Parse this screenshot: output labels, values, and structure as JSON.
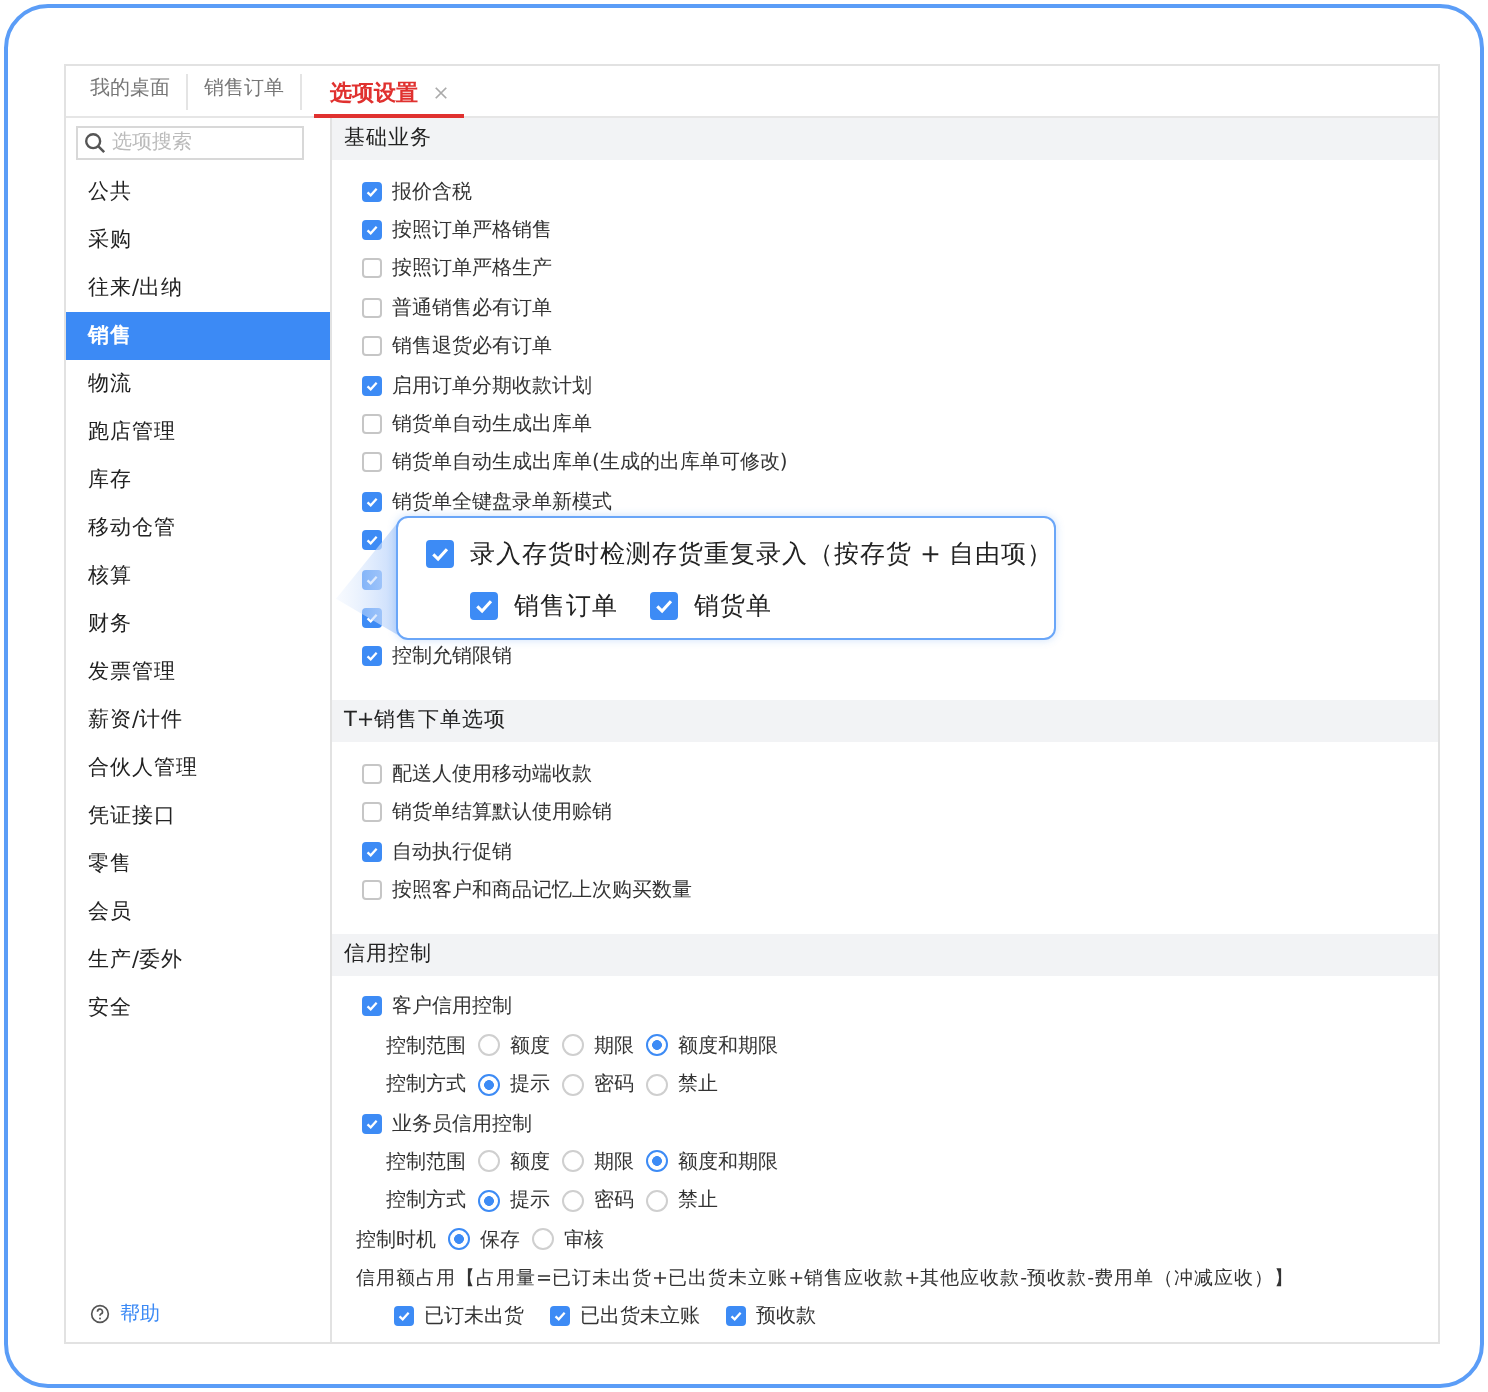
{
  "tabs": [
    {
      "label": "我的桌面",
      "selected": false,
      "closable": false
    },
    {
      "label": "销售订单",
      "selected": false,
      "closable": false
    },
    {
      "label": "选项设置",
      "selected": true,
      "closable": true
    }
  ],
  "search": {
    "placeholder": "选项搜索"
  },
  "sidebar": {
    "items": [
      {
        "label": "公共",
        "selected": false
      },
      {
        "label": "采购",
        "selected": false
      },
      {
        "label": "往来/出纳",
        "selected": false
      },
      {
        "label": "销售",
        "selected": true
      },
      {
        "label": "物流",
        "selected": false
      },
      {
        "label": "跑店管理",
        "selected": false
      },
      {
        "label": "库存",
        "selected": false
      },
      {
        "label": "移动仓管",
        "selected": false
      },
      {
        "label": "核算",
        "selected": false
      },
      {
        "label": "财务",
        "selected": false
      },
      {
        "label": "发票管理",
        "selected": false
      },
      {
        "label": "薪资/计件",
        "selected": false
      },
      {
        "label": "合伙人管理",
        "selected": false
      },
      {
        "label": "凭证接口",
        "selected": false
      },
      {
        "label": "零售",
        "selected": false
      },
      {
        "label": "会员",
        "selected": false
      },
      {
        "label": "生产/委外",
        "selected": false
      },
      {
        "label": "安全",
        "selected": false
      }
    ],
    "help": "帮助"
  },
  "sections": [
    {
      "title": "基础业务",
      "items": [
        {
          "kind": "checkbox",
          "label": "报价含税",
          "checked": true
        },
        {
          "kind": "checkbox",
          "label": "按照订单严格销售",
          "checked": true
        },
        {
          "kind": "checkbox",
          "label": "按照订单严格生产",
          "checked": false
        },
        {
          "kind": "checkbox",
          "label": "普通销售必有订单",
          "checked": false
        },
        {
          "kind": "checkbox",
          "label": "销售退货必有订单",
          "checked": false
        },
        {
          "kind": "checkbox",
          "label": "启用订单分期收款计划",
          "checked": true
        },
        {
          "kind": "checkbox",
          "label": "销货单自动生成出库单",
          "checked": false
        },
        {
          "kind": "checkbox",
          "label": "销货单自动生成出库单(生成的出库单可修改)",
          "checked": false
        },
        {
          "kind": "checkbox",
          "label": "销货单全键盘录单新模式",
          "checked": true
        },
        {
          "kind": "checkbox",
          "checked": true
        },
        {
          "kind": "checkbox",
          "checked": true
        },
        {
          "kind": "checkbox",
          "checked": true
        },
        {
          "kind": "checkbox",
          "label": "控制允销限销",
          "checked": true
        }
      ]
    },
    {
      "title": "T+销售下单选项",
      "items": [
        {
          "kind": "checkbox",
          "label": "配送人使用移动端收款",
          "checked": false
        },
        {
          "kind": "checkbox",
          "label": "销货单结算默认使用赊销",
          "checked": false
        },
        {
          "kind": "checkbox",
          "label": "自动执行促销",
          "checked": true
        },
        {
          "kind": "checkbox",
          "label": "按照客户和商品记忆上次购买数量",
          "checked": false
        }
      ]
    },
    {
      "title": "信用控制",
      "items": [
        {
          "kind": "checkbox",
          "label": "客户信用控制",
          "checked": true,
          "children": [
            {
              "kind": "radio",
              "label": "控制范围",
              "options": [
                {
                  "label": "额度",
                  "selected": false
                },
                {
                  "label": "期限",
                  "selected": false
                },
                {
                  "label": "额度和期限",
                  "selected": true
                }
              ]
            },
            {
              "kind": "radio",
              "label": "控制方式",
              "options": [
                {
                  "label": "提示",
                  "selected": true
                },
                {
                  "label": "密码",
                  "selected": false
                },
                {
                  "label": "禁止",
                  "selected": false
                }
              ]
            }
          ]
        },
        {
          "kind": "checkbox",
          "label": "业务员信用控制",
          "checked": true,
          "children": [
            {
              "kind": "radio",
              "label": "控制范围",
              "options": [
                {
                  "label": "额度",
                  "selected": false
                },
                {
                  "label": "期限",
                  "selected": false
                },
                {
                  "label": "额度和期限",
                  "selected": true
                }
              ]
            },
            {
              "kind": "radio",
              "label": "控制方式",
              "options": [
                {
                  "label": "提示",
                  "selected": true
                },
                {
                  "label": "密码",
                  "selected": false
                },
                {
                  "label": "禁止",
                  "selected": false
                }
              ]
            }
          ]
        },
        {
          "kind": "radio",
          "label": "控制时机",
          "options": [
            {
              "label": "保存",
              "selected": true
            },
            {
              "label": "审核",
              "selected": false
            }
          ]
        },
        {
          "kind": "text",
          "label": "信用额占用【占用量=已订未出货+已出货未立账+销售应收款+其他应收款-预收款-费用单（冲减应收）】",
          "children": [
            {
              "kind": "checks",
              "options": [
                {
                  "label": "已订未出货",
                  "checked": true
                },
                {
                  "label": "已出货未立账",
                  "checked": true
                },
                {
                  "label": "预收款",
                  "checked": true
                }
              ]
            }
          ]
        }
      ]
    }
  ],
  "popup": {
    "option": {
      "label": "录入存货时检测存货重复录入（按存货 + 自由项）",
      "checked": true
    },
    "choices": [
      {
        "label": "销售订单",
        "checked": true
      },
      {
        "label": "销货单",
        "checked": true
      }
    ]
  }
}
